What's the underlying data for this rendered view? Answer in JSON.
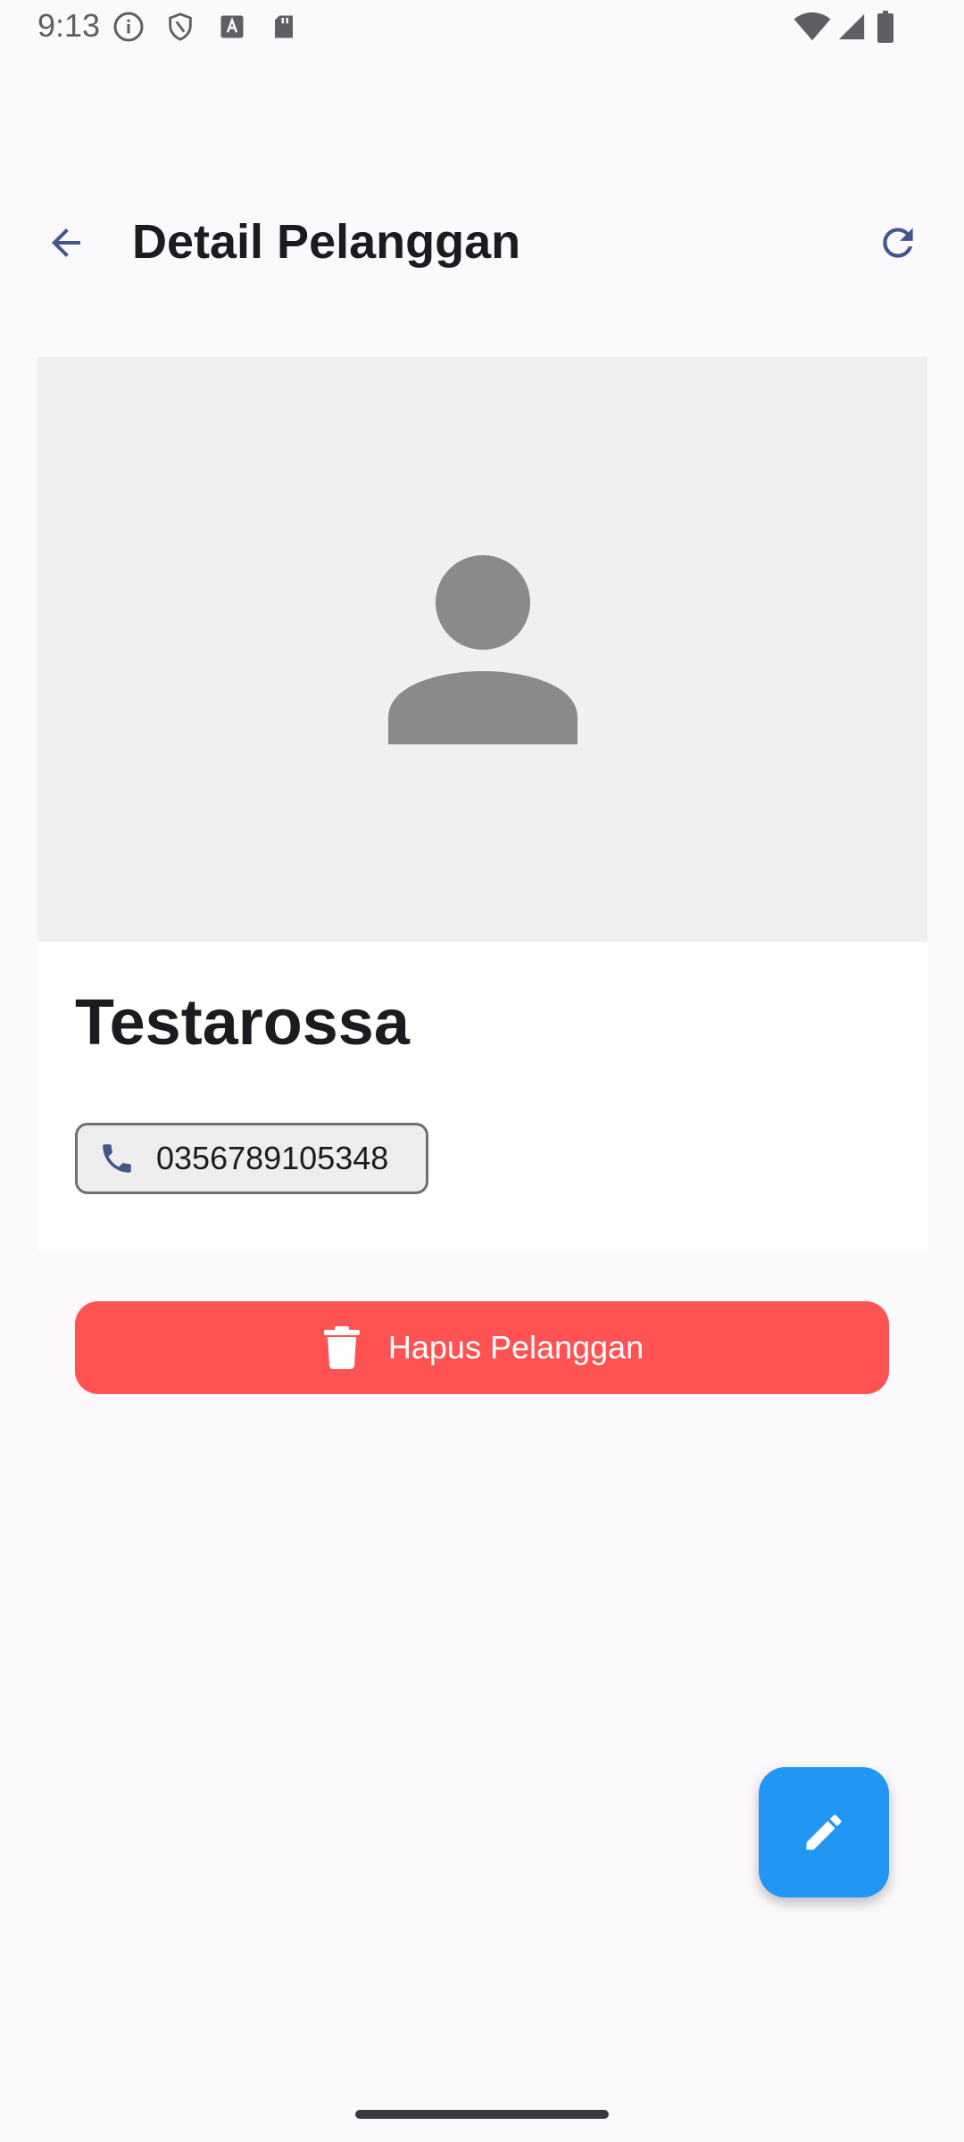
{
  "status_bar": {
    "time": "9:13"
  },
  "app_bar": {
    "title": "Detail Pelanggan"
  },
  "customer": {
    "name": "Testarossa",
    "phone": "0356789105348"
  },
  "actions": {
    "delete_label": "Hapus Pelanggan"
  },
  "icons": {
    "back": "arrow-back-icon",
    "refresh": "refresh-icon",
    "avatar": "person-placeholder-icon",
    "phone": "phone-icon",
    "delete": "trash-icon",
    "edit": "pencil-icon"
  },
  "colors": {
    "accent": "#44578c",
    "delete": "#ff5252",
    "fab": "#2196f3",
    "photo_bg": "#f0f0f0",
    "placeholder": "#8a8a8a"
  }
}
